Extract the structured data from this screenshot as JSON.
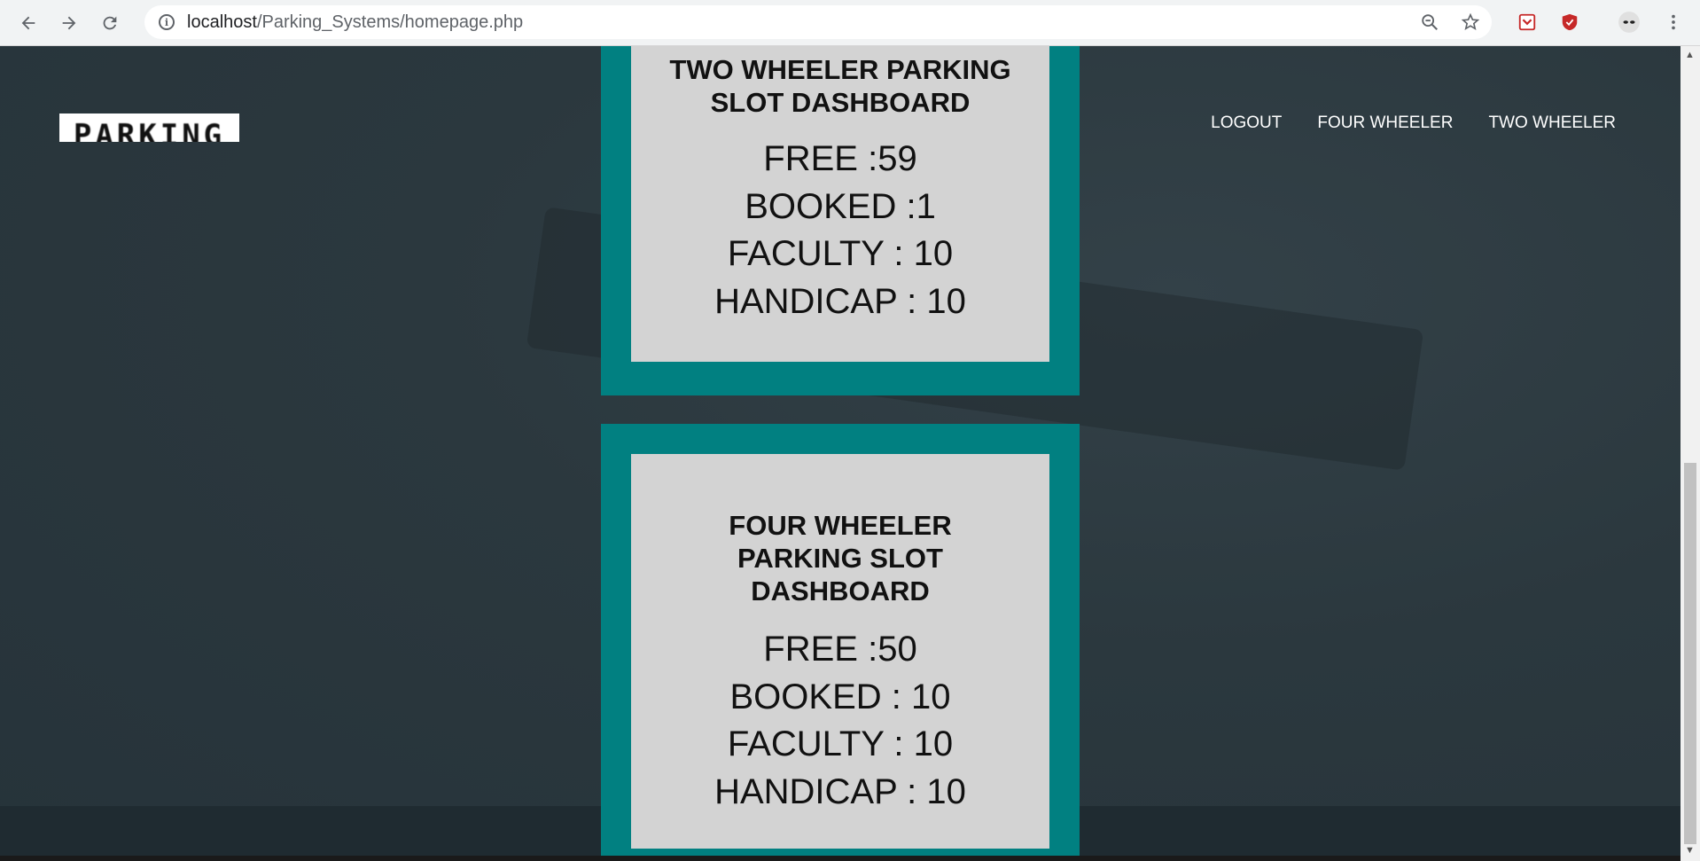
{
  "browser": {
    "url_host": "localhost",
    "url_path": "/Parking_Systems/homepage.php"
  },
  "site": {
    "logo_text": "PARKING",
    "menu": [
      {
        "label": "LOGOUT"
      },
      {
        "label": "FOUR WHEELER"
      },
      {
        "label": "TWO WHEELER"
      }
    ]
  },
  "two_wheeler": {
    "title_line1": "TWO WHEELER PARKING",
    "title_line2": "SLOT DASHBOARD",
    "free": "FREE :59",
    "booked": "BOOKED :1",
    "faculty": "FACULTY : 10",
    "handicap": "HANDICAP : 10"
  },
  "four_wheeler": {
    "title_line1": "FOUR WHEELER",
    "title_line2": "PARKING SLOT",
    "title_line3": "DASHBOARD",
    "free": "FREE :50",
    "booked": "BOOKED : 10",
    "faculty": "FACULTY : 10",
    "handicap": "HANDICAP : 10"
  },
  "colors": {
    "card_border": "#018081",
    "card_bg": "#d3d3d3"
  }
}
